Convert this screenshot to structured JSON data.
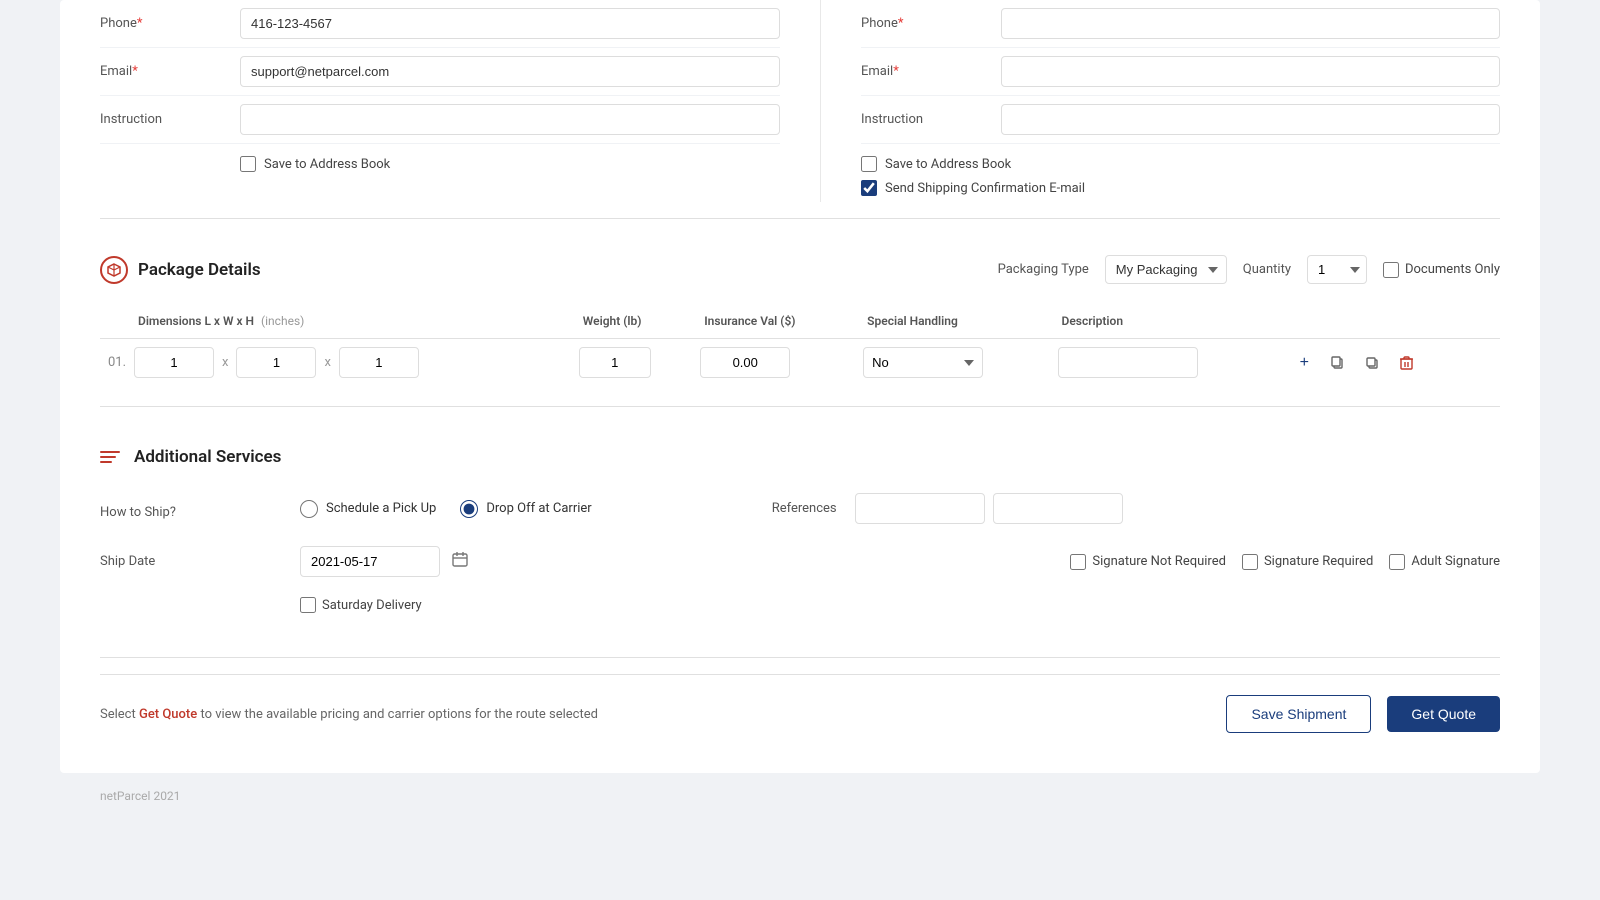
{
  "left": {
    "phone_label": "Phone",
    "phone_required": "*",
    "phone_value": "416-123-4567",
    "email_label": "Email",
    "email_required": "*",
    "email_value": "support@netparcel.com",
    "instruction_label": "Instruction",
    "instruction_value": "",
    "save_address_label": "Save to Address Book"
  },
  "right": {
    "phone_label": "Phone",
    "phone_required": "*",
    "phone_value": "",
    "email_label": "Email",
    "email_required": "*",
    "email_value": "",
    "instruction_label": "Instruction",
    "instruction_value": "",
    "save_address_label": "Save to Address Book",
    "send_confirmation_label": "Send Shipping Confirmation E-mail"
  },
  "package_details": {
    "section_title": "Package Details",
    "packaging_type_label": "Packaging Type",
    "packaging_type_value": "My Packaging",
    "quantity_label": "Quantity",
    "quantity_value": "1",
    "documents_only_label": "Documents Only",
    "columns": {
      "dimensions": "Dimensions L x W x H",
      "dimensions_unit": "(inches)",
      "weight": "Weight (lb)",
      "insurance": "Insurance Val ($)",
      "special_handling": "Special Handling",
      "description": "Description"
    },
    "row": {
      "num": "01.",
      "dim_l": "1",
      "dim_w": "1",
      "dim_h": "1",
      "weight": "1",
      "insurance": "0.00",
      "special_handling": "No",
      "description": ""
    }
  },
  "additional_services": {
    "section_title": "Additional Services",
    "how_to_ship_label": "How to Ship?",
    "schedule_pickup_label": "Schedule a Pick Up",
    "drop_off_label": "Drop Off at Carrier",
    "references_label": "References",
    "ref1_value": "",
    "ref2_value": "",
    "ship_date_label": "Ship Date",
    "ship_date_value": "2021-05-17",
    "signature_not_required_label": "Signature Not Required",
    "signature_required_label": "Signature Required",
    "adult_signature_label": "Adult Signature",
    "saturday_delivery_label": "Saturday Delivery"
  },
  "footer": {
    "note_prefix": "Select",
    "get_quote_link": "Get Quote",
    "note_suffix": "to view the available pricing and carrier options for the route selected",
    "save_shipment_label": "Save Shipment",
    "get_quote_label": "Get Quote"
  },
  "page_footer": {
    "text": "netParcel 2021"
  }
}
